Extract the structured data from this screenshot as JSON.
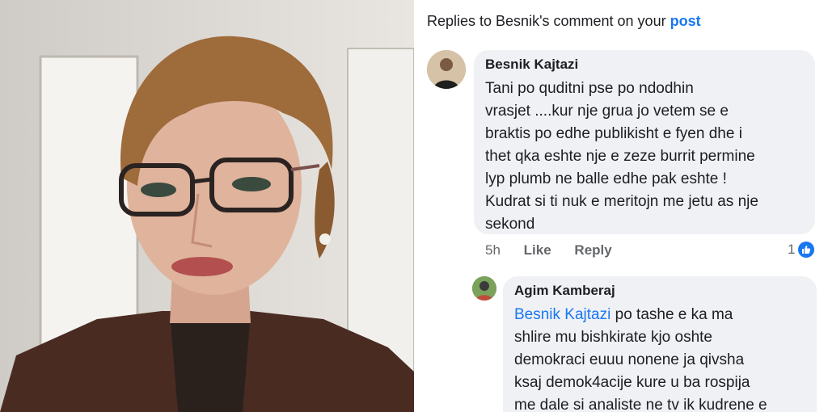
{
  "header": {
    "prefix": "Replies to Besnik's comment on your",
    "link": "post"
  },
  "comment": {
    "author": "Besnik Kajtazi",
    "lines": [
      "Tani po quditni pse po ndodhin",
      "vrasjet ....kur nje grua jo vetem se e",
      "braktis po edhe publikisht e fyen dhe i",
      "thet qka eshte nje e zeze burrit permine",
      "lyp plumb ne balle edhe pak eshte !",
      "Kudrat si ti nuk e meritojn me jetu as nje",
      "sekond"
    ],
    "time": "5h",
    "like_label": "Like",
    "reply_label": "Reply",
    "reaction_count": "1"
  },
  "reply": {
    "author": "Agim Kamberaj",
    "mention": "Besnik Kajtazi",
    "first_line_rest": " po tashe e ka ma",
    "lines": [
      "shlire mu bishkirate kjo oshte",
      "demokraci euuu nonene ja qivsha",
      "ksaj demok4acije kure u ba rospija",
      "me dale si analiste ne tv ik kudrene e"
    ]
  },
  "colors": {
    "link": "#1877f2",
    "bubble": "#eff1f4",
    "meta_text": "#65676b"
  },
  "icons": [
    "avatar",
    "like-reaction-icon"
  ]
}
